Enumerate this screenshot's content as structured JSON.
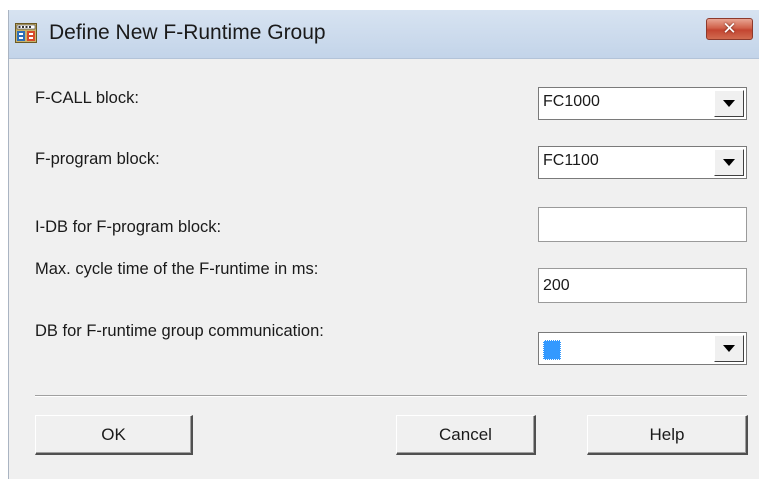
{
  "window": {
    "title": "Define New F-Runtime Group",
    "close_glyph": "✕"
  },
  "icons": {
    "app": "f-runtime-app-icon",
    "close": "close-icon",
    "dropdown": "chevron-down-icon"
  },
  "form": {
    "fcall_label": "F-CALL block:",
    "fcall_value": "FC1000",
    "fprogram_label": "F-program block:",
    "fprogram_value": "FC1100",
    "idb_label": "I-DB for F-program block:",
    "idb_value": "",
    "maxcycle_label": "Max. cycle time of the F-runtime in ms:",
    "maxcycle_value": "200",
    "dbcomm_label": "DB for F-runtime group communication:",
    "dbcomm_value": ""
  },
  "buttons": {
    "ok": "OK",
    "cancel": "Cancel",
    "help": "Help"
  },
  "colors": {
    "close_button": "#c84c35",
    "selection": "#3399ff",
    "dialog_bg": "#f0f0f0"
  }
}
